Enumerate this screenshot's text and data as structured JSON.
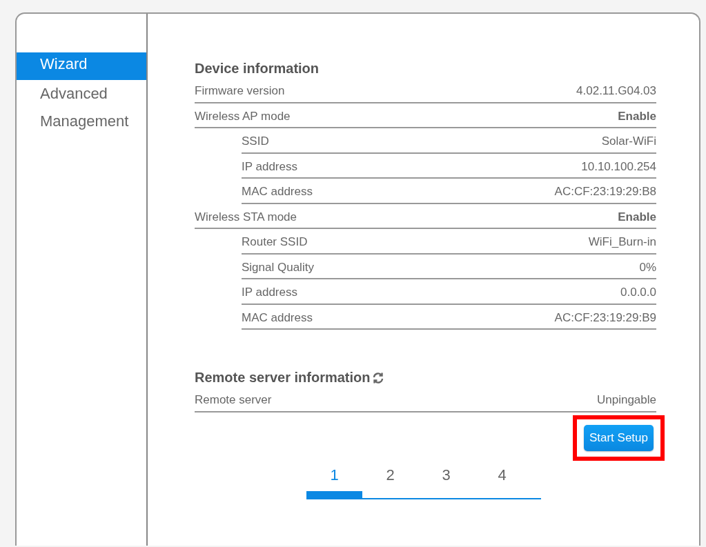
{
  "sidebar": {
    "items": [
      {
        "label": "Wizard",
        "selected": true
      },
      {
        "label": "Advanced",
        "selected": false
      },
      {
        "label": "Management",
        "selected": false
      }
    ]
  },
  "device_information": {
    "title": "Device information",
    "rows": [
      {
        "label": "Firmware version",
        "value": "4.02.11.G04.03"
      },
      {
        "label": "Wireless AP mode",
        "value": "Enable",
        "children": [
          {
            "label": "SSID",
            "value": "Solar-WiFi"
          },
          {
            "label": "IP address",
            "value": "10.10.100.254"
          },
          {
            "label": "MAC address",
            "value": "AC:CF:23:19:29:B8"
          }
        ]
      },
      {
        "label": "Wireless STA mode",
        "value": "Enable",
        "children": [
          {
            "label": "Router SSID",
            "value": "WiFi_Burn-in"
          },
          {
            "label": "Signal Quality",
            "value": "0%"
          },
          {
            "label": "IP address",
            "value": "0.0.0.0"
          },
          {
            "label": "MAC address",
            "value": "AC:CF:23:19:29:B9"
          }
        ]
      }
    ]
  },
  "remote_server_information": {
    "title": "Remote server information",
    "rows": [
      {
        "label": "Remote server",
        "value": "Unpingable"
      }
    ]
  },
  "start_button": {
    "label": "Start Setup",
    "highlighted": true
  },
  "steps": [
    {
      "label": "1",
      "selected": true
    },
    {
      "label": "2",
      "selected": false
    },
    {
      "label": "3",
      "selected": false
    },
    {
      "label": "4",
      "selected": false
    }
  ]
}
